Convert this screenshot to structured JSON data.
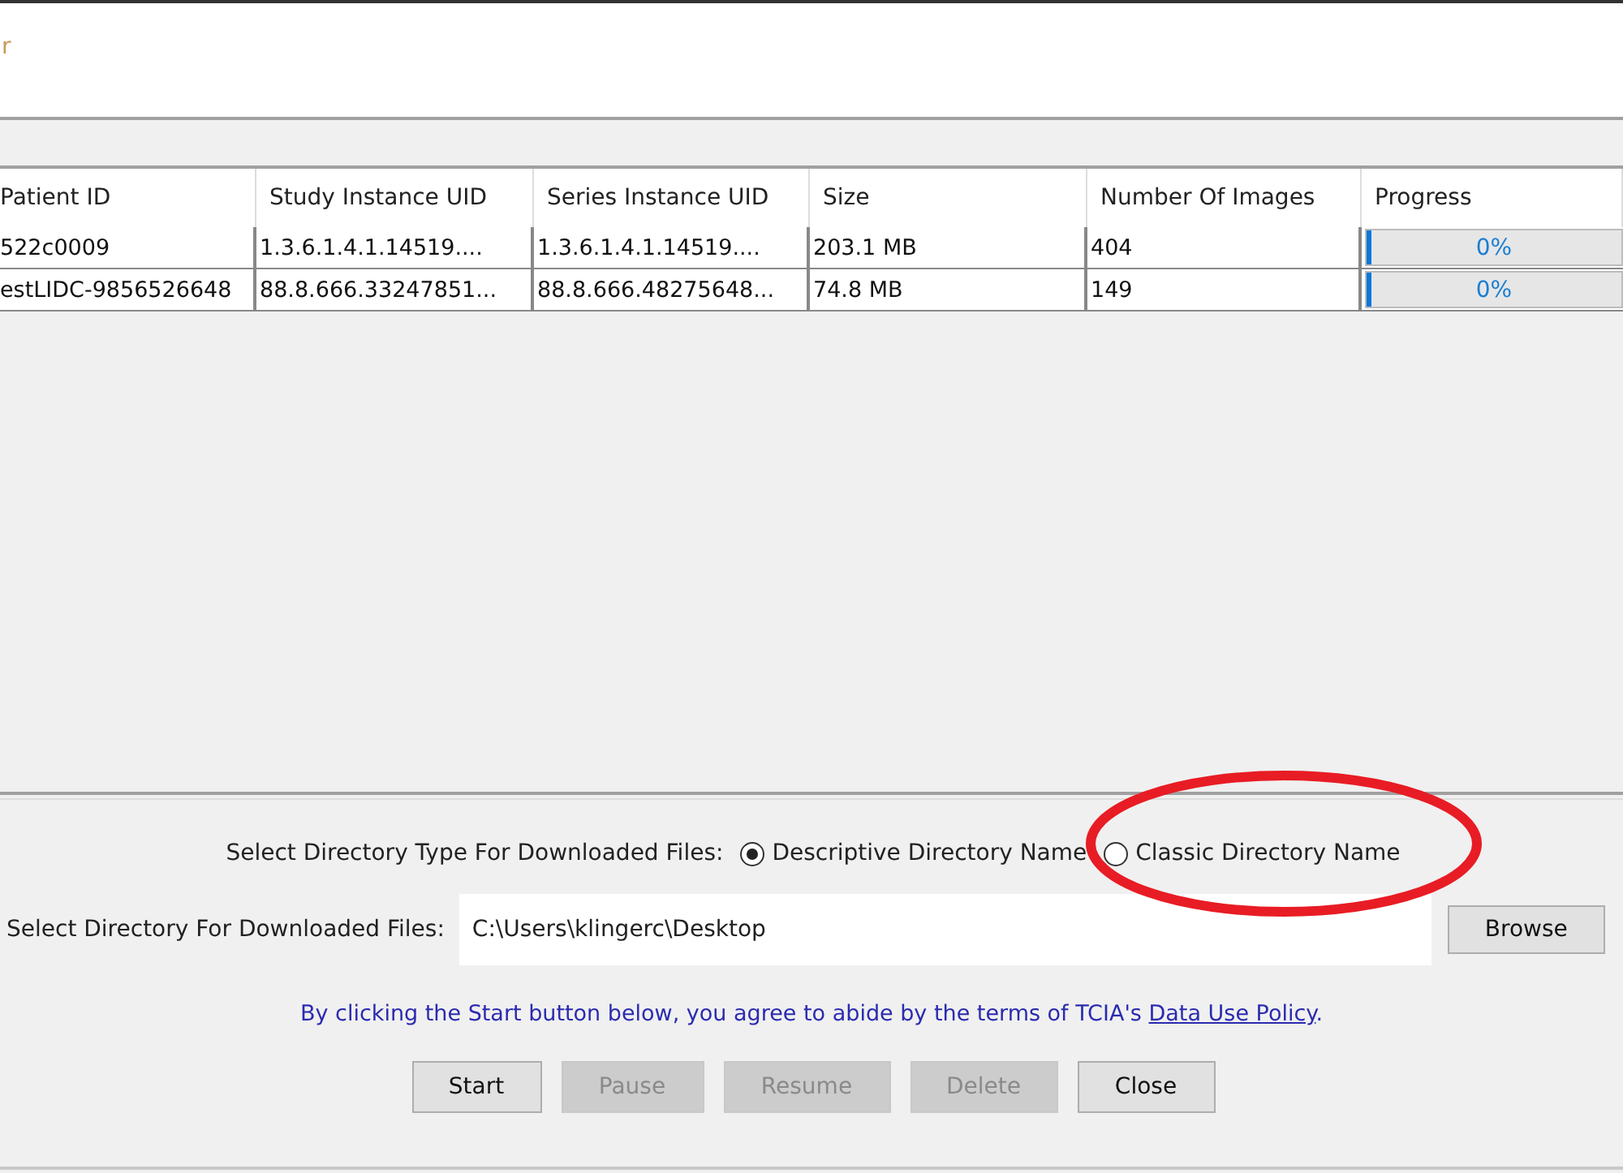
{
  "header": {
    "text": "r"
  },
  "table": {
    "columns": [
      "Patient ID",
      "Study Instance UID",
      "Series Instance UID",
      "Size",
      "Number Of Images",
      "Progress"
    ],
    "rows": [
      {
        "patient_id": "522c0009",
        "study_uid": "1.3.6.1.4.1.14519....",
        "series_uid": "1.3.6.1.4.1.14519....",
        "size": "203.1 MB",
        "images": "404",
        "progress": {
          "level": 0,
          "reading": "0%"
        }
      },
      {
        "patient_id": "estLIDC-9856526648",
        "study_uid": "88.8.666.33247851...",
        "series_uid": "88.8.666.48275648...",
        "size": "74.8 MB",
        "images": "149",
        "progress": {
          "level": 0,
          "reading": "0%"
        }
      }
    ]
  },
  "directory_type": {
    "label": "Select Directory Type For Downloaded Files:",
    "options": [
      {
        "label": "Descriptive Directory Name",
        "selected": true
      },
      {
        "label": "Classic Directory Name",
        "selected": false
      }
    ]
  },
  "directory": {
    "label": "Select Directory For Downloaded Files:",
    "value": "C:\\Users\\klingerc\\Desktop",
    "browse": "Browse"
  },
  "notice": {
    "text": "By clicking the Start button below, you agree to abide by the terms of TCIA's",
    "link": "Data Use Policy",
    "after": "."
  },
  "buttons": [
    {
      "label": "Start",
      "disabled": false
    },
    {
      "label": "Pause",
      "disabled": true
    },
    {
      "label": "Resume",
      "disabled": true
    },
    {
      "label": "Delete",
      "disabled": true
    },
    {
      "label": "Close",
      "disabled": false
    }
  ],
  "annotations": [
    {
      "kind": "ellipse",
      "color": "#e81c24"
    }
  ]
}
